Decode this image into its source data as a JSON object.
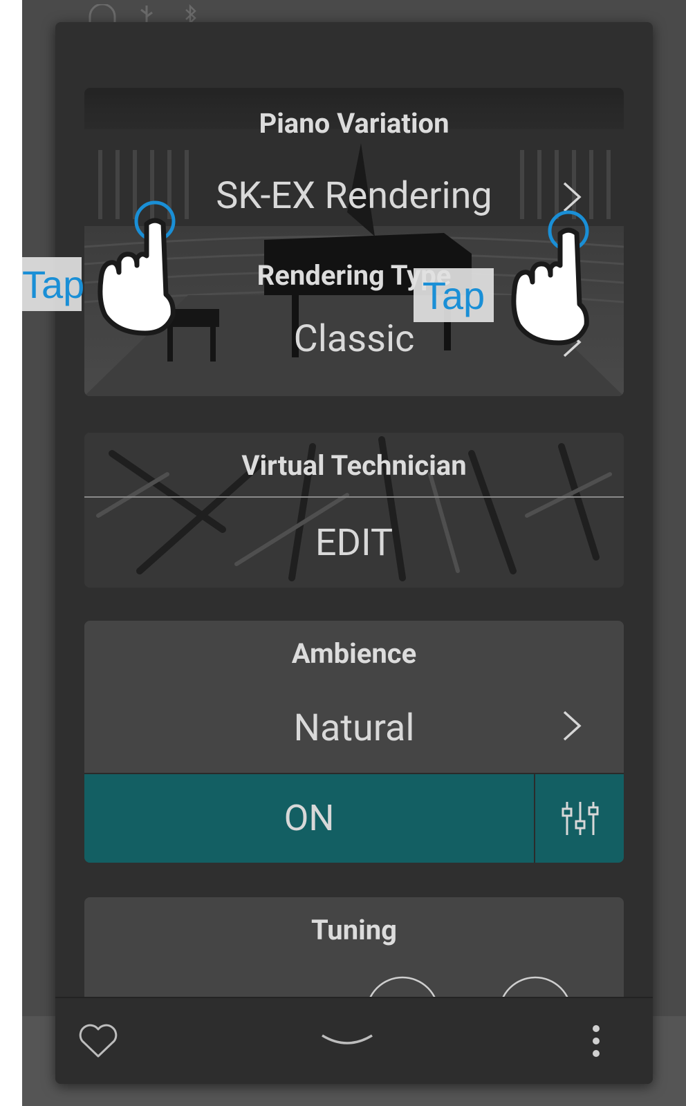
{
  "status_icons": [
    "headphones-icon",
    "usb-icon",
    "bluetooth-icon"
  ],
  "piano_variation": {
    "title": "Piano Variation",
    "value": "SK-EX Rendering",
    "sub_title": "Rendering Type",
    "sub_value": "Classic"
  },
  "virtual_technician": {
    "title": "Virtual Technician",
    "button": "EDIT"
  },
  "ambience": {
    "title": "Ambience",
    "value": "Natural",
    "toggle": "ON"
  },
  "tuning": {
    "title": "Tuning"
  },
  "annotations": {
    "tap_left": "Tap",
    "tap_right": "Tap"
  },
  "colors": {
    "accent_teal": "#135f63",
    "tap_blue": "#1a8fd6"
  },
  "bottom_bar": {
    "icons": [
      "heart-icon",
      "chevron-down-icon",
      "more-vertical-icon"
    ]
  }
}
